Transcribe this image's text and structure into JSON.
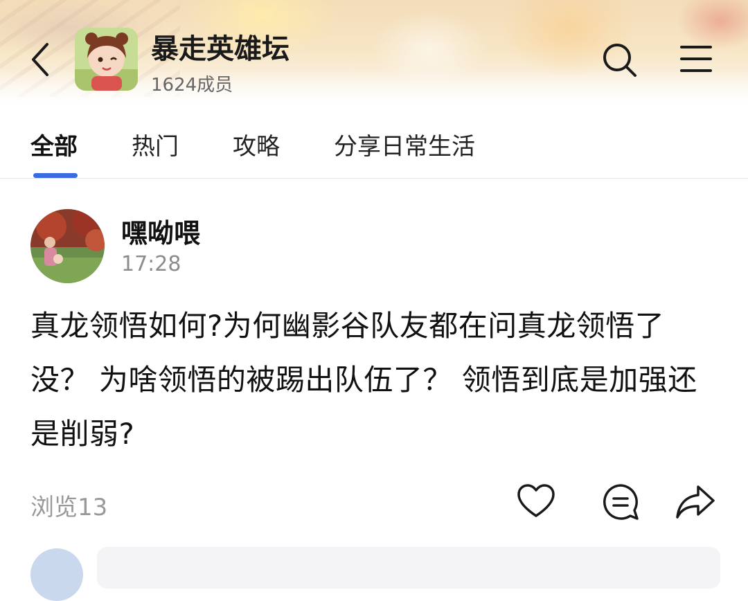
{
  "header": {
    "group_title": "暴走英雄坛",
    "member_count": "1624成员",
    "icons": [
      "back-arrow-icon",
      "search-icon",
      "menu-icon"
    ]
  },
  "tabs": [
    {
      "label": "全部",
      "active": true
    },
    {
      "label": "热门",
      "active": false
    },
    {
      "label": "攻略",
      "active": false
    },
    {
      "label": "分享日常生活",
      "active": false
    }
  ],
  "colors": {
    "accent": "#3b6be3",
    "secondary_text": "#8c8c8c"
  },
  "post": {
    "author": "嘿呦喂",
    "time": "17:28",
    "body": "真龙领悟如何?为何幽影谷队友都在问真龙领悟了没？ 为啥领悟的被踢出队伍了？ 领悟到底是加强还是削弱?",
    "views": "浏览13",
    "actions": [
      "heart-icon",
      "comment-icon",
      "share-icon"
    ]
  }
}
